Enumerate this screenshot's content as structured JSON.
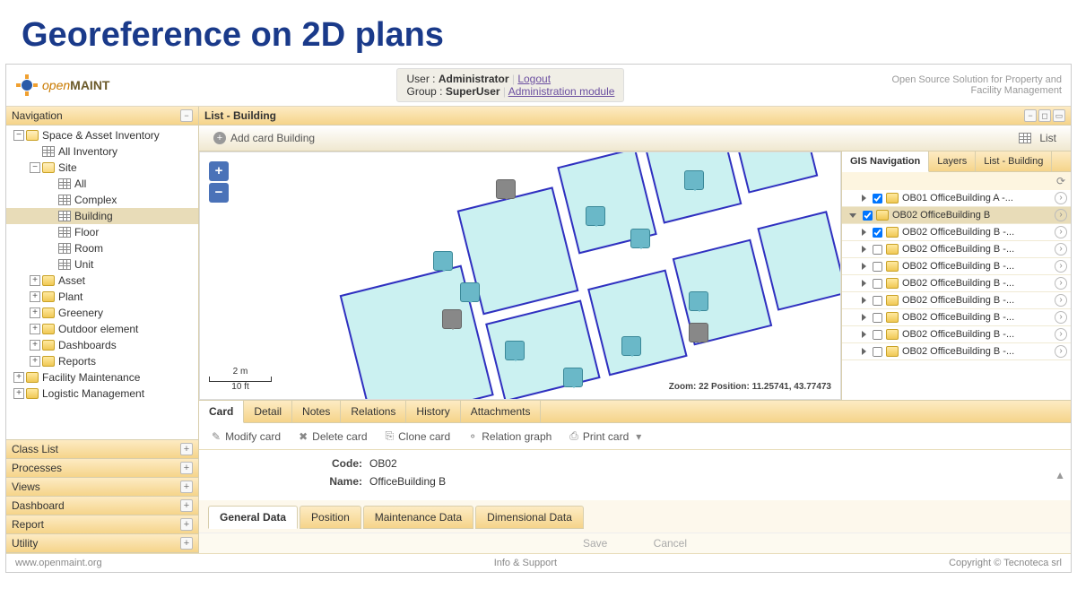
{
  "slide_title": "Georeference on 2D plans",
  "logo": {
    "brand_a": "open",
    "brand_b": "MAINT"
  },
  "header": {
    "user_label": "User :",
    "user_value": "Administrator",
    "logout": "Logout",
    "group_label": "Group :",
    "group_value": "SuperUser",
    "admin_link": "Administration module",
    "tagline1": "Open Source Solution for Property and",
    "tagline2": "Facility Management"
  },
  "nav": {
    "title": "Navigation",
    "tree": [
      {
        "label": "Space & Asset Inventory",
        "type": "folder-open",
        "indent": 0,
        "toggle": "−"
      },
      {
        "label": "All Inventory",
        "type": "grid",
        "indent": 1
      },
      {
        "label": "Site",
        "type": "folder-open",
        "indent": 1,
        "toggle": "−"
      },
      {
        "label": "All",
        "type": "grid",
        "indent": 2
      },
      {
        "label": "Complex",
        "type": "grid",
        "indent": 2
      },
      {
        "label": "Building",
        "type": "grid",
        "indent": 2,
        "selected": true
      },
      {
        "label": "Floor",
        "type": "grid",
        "indent": 2
      },
      {
        "label": "Room",
        "type": "grid",
        "indent": 2
      },
      {
        "label": "Unit",
        "type": "grid",
        "indent": 2
      },
      {
        "label": "Asset",
        "type": "folder",
        "indent": 1,
        "toggle": "+"
      },
      {
        "label": "Plant",
        "type": "folder",
        "indent": 1,
        "toggle": "+"
      },
      {
        "label": "Greenery",
        "type": "folder",
        "indent": 1,
        "toggle": "+"
      },
      {
        "label": "Outdoor element",
        "type": "folder",
        "indent": 1,
        "toggle": "+"
      },
      {
        "label": "Dashboards",
        "type": "folder",
        "indent": 1,
        "toggle": "+"
      },
      {
        "label": "Reports",
        "type": "folder",
        "indent": 1,
        "toggle": "+"
      },
      {
        "label": "Facility Maintenance",
        "type": "folder",
        "indent": 0,
        "toggle": "+"
      },
      {
        "label": "Logistic Management",
        "type": "folder",
        "indent": 0,
        "toggle": "+"
      }
    ],
    "accordion": [
      "Class List",
      "Processes",
      "Views",
      "Dashboard",
      "Report",
      "Utility"
    ]
  },
  "content": {
    "list_title": "List - Building",
    "add_card": "Add card Building",
    "list_btn": "List",
    "zoom_status": "Zoom: 22 Position: 11.25741, 43.77473",
    "scale_top": "2 m",
    "scale_bot": "10 ft"
  },
  "gis": {
    "tabs": [
      "GIS Navigation",
      "Layers",
      "List - Building"
    ],
    "rows": [
      {
        "indent": 1,
        "checked": true,
        "label": "OB01 OfficeBuilding A -...",
        "tri": "right"
      },
      {
        "indent": 0,
        "checked": true,
        "label": "OB02 OfficeBuilding B",
        "tri": "down",
        "selected": true
      },
      {
        "indent": 1,
        "checked": true,
        "label": "OB02 OfficeBuilding B -...",
        "tri": "right"
      },
      {
        "indent": 1,
        "checked": false,
        "label": "OB02 OfficeBuilding B -...",
        "tri": "right"
      },
      {
        "indent": 1,
        "checked": false,
        "label": "OB02 OfficeBuilding B -...",
        "tri": "right"
      },
      {
        "indent": 1,
        "checked": false,
        "label": "OB02 OfficeBuilding B -...",
        "tri": "right"
      },
      {
        "indent": 1,
        "checked": false,
        "label": "OB02 OfficeBuilding B -...",
        "tri": "right"
      },
      {
        "indent": 1,
        "checked": false,
        "label": "OB02 OfficeBuilding B -...",
        "tri": "right"
      },
      {
        "indent": 1,
        "checked": false,
        "label": "OB02 OfficeBuilding B -...",
        "tri": "right"
      },
      {
        "indent": 1,
        "checked": false,
        "label": "OB02 OfficeBuilding B -...",
        "tri": "right"
      }
    ]
  },
  "card": {
    "tabs": [
      "Card",
      "Detail",
      "Notes",
      "Relations",
      "History",
      "Attachments"
    ],
    "actions": [
      "Modify card",
      "Delete card",
      "Clone card",
      "Relation graph",
      "Print card"
    ],
    "code_label": "Code:",
    "code_value": "OB02",
    "name_label": "Name:",
    "name_value": "OfficeBuilding B",
    "sub_tabs": [
      "General Data",
      "Position",
      "Maintenance Data",
      "Dimensional Data"
    ],
    "save": "Save",
    "cancel": "Cancel"
  },
  "footer": {
    "left": "www.openmaint.org",
    "center": "Info & Support",
    "right": "Copyright © Tecnoteca srl"
  }
}
